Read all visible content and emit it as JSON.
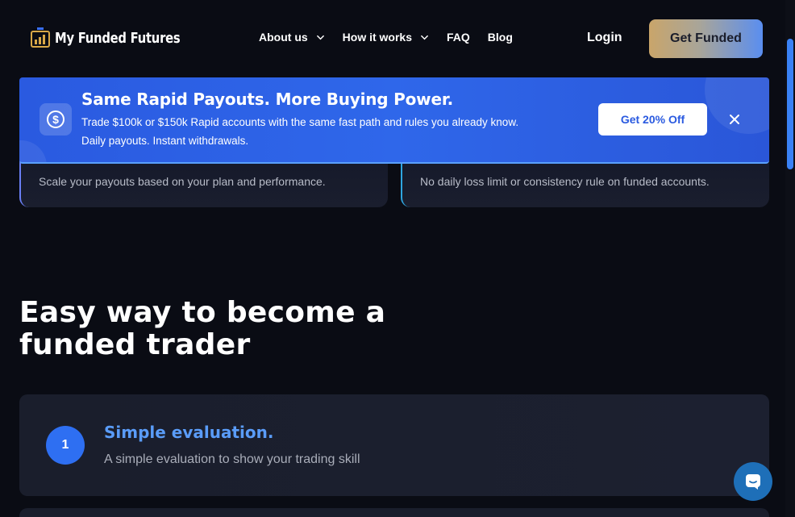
{
  "brand": {
    "name": "My Funded Futures"
  },
  "nav": {
    "items": [
      {
        "label": "About us",
        "has_dropdown": true
      },
      {
        "label": "How it works",
        "has_dropdown": true
      },
      {
        "label": "FAQ",
        "has_dropdown": false
      },
      {
        "label": "Blog",
        "has_dropdown": false
      }
    ],
    "login_label": "Login",
    "cta_label": "Get Funded"
  },
  "banner": {
    "title": "Same Rapid Payouts. More Buying Power.",
    "line1": "Trade $100k or $150k Rapid accounts with the same fast path and rules you already know.",
    "line2": "Daily payouts. Instant withdrawals.",
    "cta_label": "Get 20% Off",
    "icon": "dollar-coin-icon"
  },
  "features": [
    {
      "text": "Scale your payouts based on your plan and performance."
    },
    {
      "text": "No daily loss limit or consistency rule on funded accounts."
    }
  ],
  "section": {
    "title": "Easy way to become a funded trader"
  },
  "steps": [
    {
      "number": "1",
      "title": "Simple evaluation.",
      "description": "A simple evaluation to show your trading skill"
    }
  ],
  "colors": {
    "background": "#0a0c14",
    "banner": "#2f67ea",
    "accent_blue": "#2e6ff2",
    "step_title": "#5a9cf8",
    "cta_gradient_start": "#c9a56a",
    "cta_gradient_end": "#5a8ef0"
  }
}
